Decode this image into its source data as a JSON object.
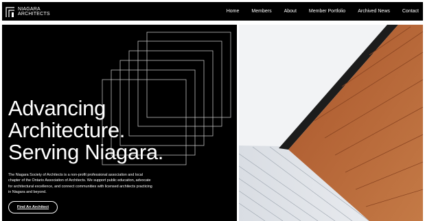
{
  "brand": {
    "line1": "NIAGARA",
    "line2": "ARCHITECTS"
  },
  "nav": {
    "items": [
      {
        "label": "Home"
      },
      {
        "label": "Members"
      },
      {
        "label": "About"
      },
      {
        "label": "Member Portfolio"
      },
      {
        "label": "Archived News"
      },
      {
        "label": "Contact"
      }
    ]
  },
  "hero": {
    "headline_lines": [
      "Advancing",
      "Architecture.",
      "Serving Niagara."
    ],
    "description": "The Niagara Society of Architects is a non-profit professional association and local chapter of the Ontario Association of Architects. We support public education, advocate for architectural excellence, and connect communities with licensed architects practicing in Niagara and beyond.",
    "cta_label": "Find An Architect"
  },
  "colors": {
    "background": "#000000",
    "text": "#ffffff",
    "facade_copper": "#b9683a",
    "sky": "#f2f3f5"
  },
  "icons": {
    "logo": "niagara-architects-logo-mark",
    "decor": "nested-outline-squares"
  }
}
